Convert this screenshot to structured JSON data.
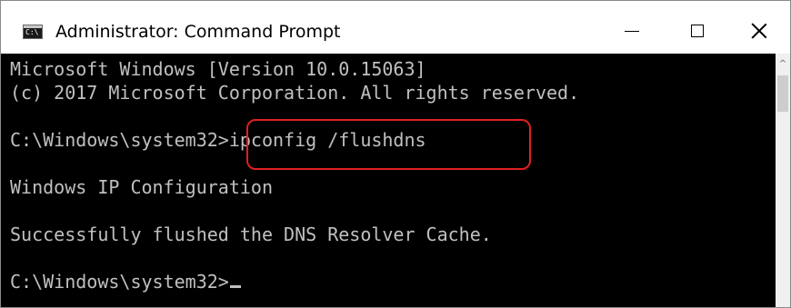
{
  "window": {
    "title": "Administrator: Command Prompt",
    "icon": "cmd-icon"
  },
  "caption_buttons": {
    "minimize_icon": "minimize-icon",
    "maximize_icon": "maximize-icon",
    "close_icon": "close-icon"
  },
  "console": {
    "lines": [
      "Microsoft Windows [Version 10.0.15063]",
      "(c) 2017 Microsoft Corporation. All rights reserved.",
      "C:\\Windows\\system32>ipconfig /flushdns",
      "Windows IP Configuration",
      "Successfully flushed the DNS Resolver Cache.",
      "C:\\Windows\\system32>"
    ]
  },
  "scrollbar": {
    "up_arrow": "^"
  },
  "colors": {
    "console_bg": "#000000",
    "console_text": "#c0c0c0",
    "highlight_border": "#e02020",
    "titlebar_bg": "#ffffff"
  }
}
